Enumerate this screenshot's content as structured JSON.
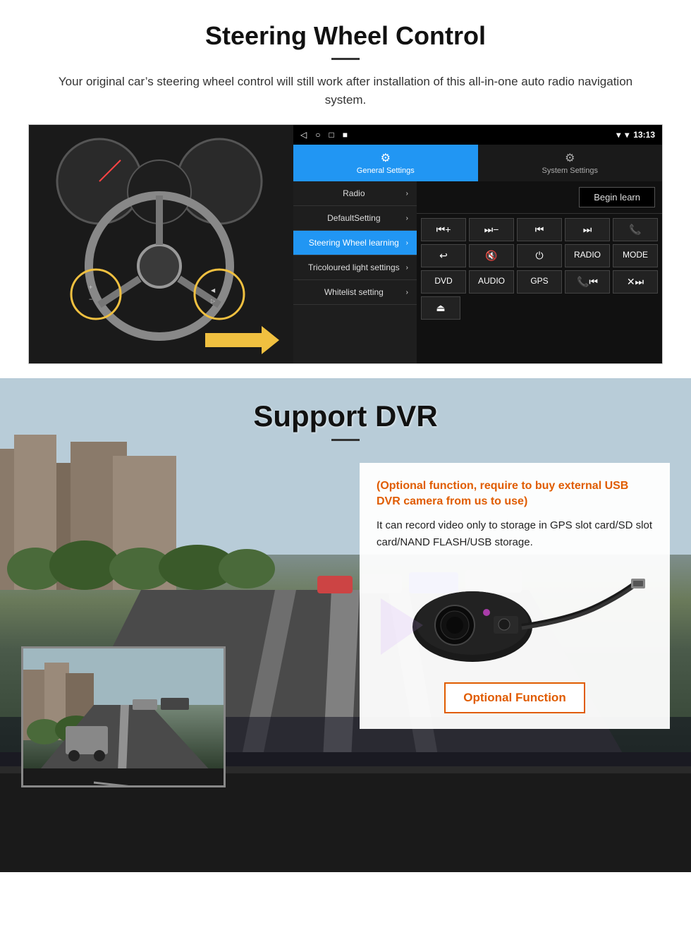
{
  "page": {
    "steering_section": {
      "title": "Steering Wheel Control",
      "subtitle": "Your original car’s steering wheel control will still work after installation of this all-in-one auto radio navigation system.",
      "topbar": {
        "time": "13:13",
        "nav_icons": [
          "◁",
          "○",
          "□",
          "■"
        ]
      },
      "tabs": [
        {
          "label": "General Settings",
          "active": true
        },
        {
          "label": "System Settings",
          "active": false
        }
      ],
      "menu_items": [
        {
          "label": "Radio",
          "active": false
        },
        {
          "label": "DefaultSetting",
          "active": false
        },
        {
          "label": "Steering Wheel learning",
          "active": true
        },
        {
          "label": "Tricoloured light settings",
          "active": false
        },
        {
          "label": "Whitelist setting",
          "active": false
        }
      ],
      "begin_learn_label": "Begin learn",
      "control_rows": [
        [
          "⏮+",
          "⏭−",
          "⏮",
          "⏭",
          "📞"
        ],
        [
          "↩",
          "🔇x",
          "⏻",
          "RADIO",
          "MODE"
        ],
        [
          "DVD",
          "AUDIO",
          "GPS",
          "📞⏮",
          "✕⏭"
        ],
        [
          "⏏"
        ]
      ]
    },
    "dvr_section": {
      "title": "Support DVR",
      "optional_text": "(Optional function, require to buy external USB DVR camera from us to use)",
      "body_text": "It can record video only to storage in GPS slot card/SD slot card/NAND FLASH/USB storage.",
      "optional_func_label": "Optional Function"
    }
  }
}
